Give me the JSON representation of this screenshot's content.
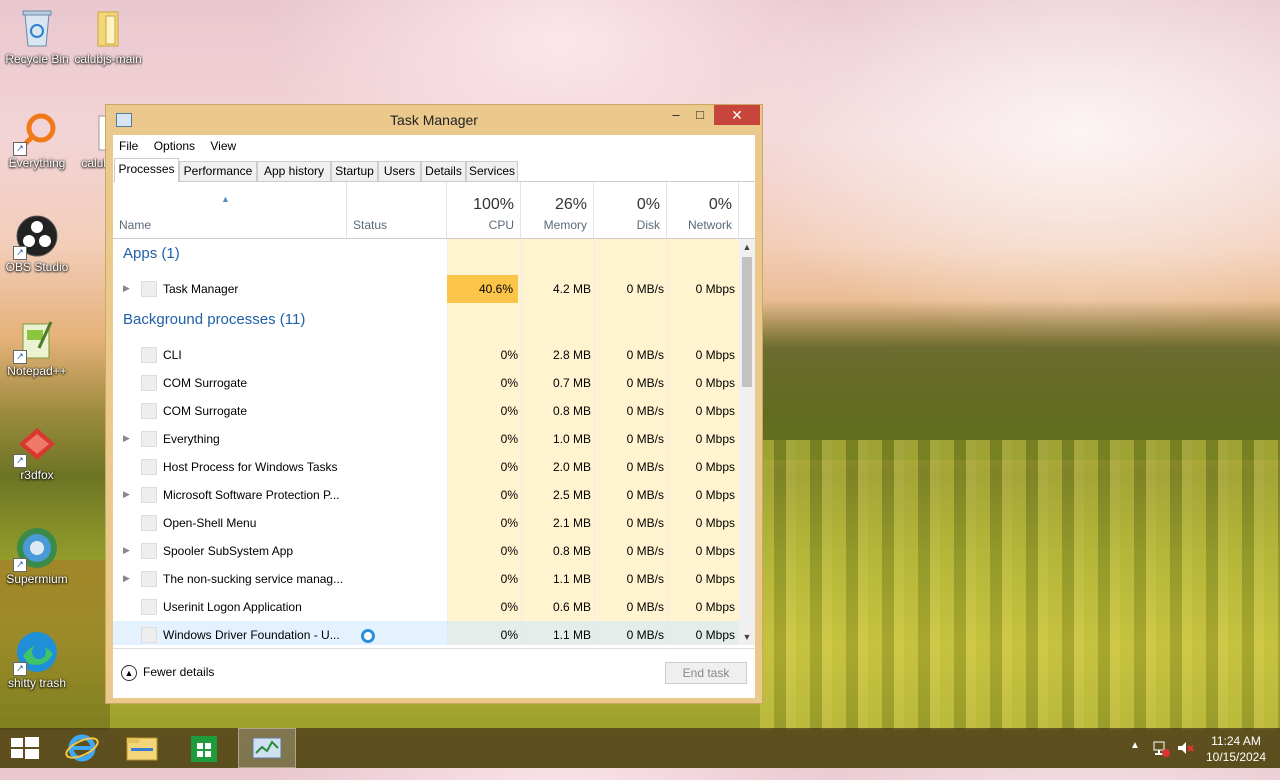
{
  "desktop": {
    "icons": [
      {
        "label": "Recycle Bin",
        "icon": "recycle-bin-icon"
      },
      {
        "label": "calubjs-main",
        "icon": "folder-icon"
      },
      {
        "label": "Everything",
        "icon": "everything-search-icon"
      },
      {
        "label": "calub",
        "icon": "file-icon"
      },
      {
        "label": "OBS Studio",
        "icon": "obs-icon"
      },
      {
        "label": "Notepad++",
        "icon": "notepad-plus-icon"
      },
      {
        "label": "r3dfox",
        "icon": "r3dfox-icon"
      },
      {
        "label": "Supermium",
        "icon": "supermium-icon"
      },
      {
        "label": "shitty trash",
        "icon": "edge-icon"
      }
    ]
  },
  "window": {
    "title": "Task Manager",
    "minimize": "–",
    "maximize": "□",
    "close": "✕",
    "menu": [
      "File",
      "Options",
      "View"
    ],
    "tabs": [
      "Processes",
      "Performance",
      "App history",
      "Startup",
      "Users",
      "Details",
      "Services"
    ],
    "active_tab": "Processes"
  },
  "columns": {
    "name": "Name",
    "status": "Status",
    "cpu": {
      "pct": "100%",
      "label": "CPU"
    },
    "memory": {
      "pct": "26%",
      "label": "Memory"
    },
    "disk": {
      "pct": "0%",
      "label": "Disk"
    },
    "network": {
      "pct": "0%",
      "label": "Network"
    }
  },
  "groups": {
    "apps": "Apps (1)",
    "background": "Background processes (11)"
  },
  "apps": [
    {
      "name": "Task Manager",
      "expandable": true,
      "cpu": "40.6%",
      "memory": "4.2 MB",
      "disk": "0 MB/s",
      "network": "0 Mbps"
    }
  ],
  "background": [
    {
      "name": "CLI",
      "expandable": false,
      "cpu": "0%",
      "memory": "2.8 MB",
      "disk": "0 MB/s",
      "network": "0 Mbps"
    },
    {
      "name": "COM Surrogate",
      "expandable": false,
      "cpu": "0%",
      "memory": "0.7 MB",
      "disk": "0 MB/s",
      "network": "0 Mbps"
    },
    {
      "name": "COM Surrogate",
      "expandable": false,
      "cpu": "0%",
      "memory": "0.8 MB",
      "disk": "0 MB/s",
      "network": "0 Mbps"
    },
    {
      "name": "Everything",
      "expandable": true,
      "cpu": "0%",
      "memory": "1.0 MB",
      "disk": "0 MB/s",
      "network": "0 Mbps"
    },
    {
      "name": "Host Process for Windows Tasks",
      "expandable": false,
      "cpu": "0%",
      "memory": "2.0 MB",
      "disk": "0 MB/s",
      "network": "0 Mbps"
    },
    {
      "name": "Microsoft Software Protection P...",
      "expandable": true,
      "cpu": "0%",
      "memory": "2.5 MB",
      "disk": "0 MB/s",
      "network": "0 Mbps"
    },
    {
      "name": "Open-Shell Menu",
      "expandable": false,
      "cpu": "0%",
      "memory": "2.1 MB",
      "disk": "0 MB/s",
      "network": "0 Mbps"
    },
    {
      "name": "Spooler SubSystem App",
      "expandable": true,
      "cpu": "0%",
      "memory": "0.8 MB",
      "disk": "0 MB/s",
      "network": "0 Mbps"
    },
    {
      "name": "The non-sucking service manag...",
      "expandable": true,
      "cpu": "0%",
      "memory": "1.1 MB",
      "disk": "0 MB/s",
      "network": "0 Mbps"
    },
    {
      "name": "Userinit Logon Application",
      "expandable": false,
      "cpu": "0%",
      "memory": "0.6 MB",
      "disk": "0 MB/s",
      "network": "0 Mbps"
    },
    {
      "name": "Windows Driver Foundation - U...",
      "expandable": false,
      "cpu": "0%",
      "memory": "1.1 MB",
      "disk": "0 MB/s",
      "network": "0 Mbps"
    }
  ],
  "footer": {
    "fewer_details": "Fewer details",
    "end_task": "End task"
  },
  "taskbar": {
    "items": [
      "start-icon",
      "internet-explorer-icon",
      "file-explorer-icon",
      "store-icon",
      "task-manager-icon"
    ],
    "time": "11:24 AM",
    "date": "10/15/2024"
  },
  "colors": {
    "cpu_high": "#fbc54a",
    "col_tint": "#fff4cf",
    "group_blue": "#1e5fa8"
  }
}
